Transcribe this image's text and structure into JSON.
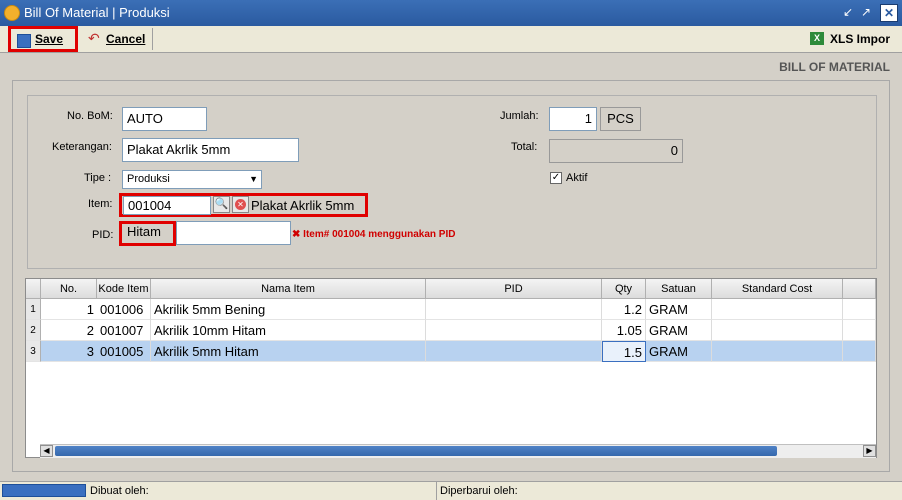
{
  "window": {
    "title": "Bill Of Material | Produksi"
  },
  "toolbar": {
    "save_label": "Save",
    "cancel_label": "Cancel",
    "xls_label": "XLS Impor"
  },
  "heading": "BILL OF MATERIAL",
  "form": {
    "no_bom_label": "No. BoM:",
    "no_bom_value": "AUTO",
    "keterangan_label": "Keterangan:",
    "keterangan_value": "Plakat Akrlik 5mm",
    "tipe_label": "Tipe :",
    "tipe_value": "Produksi",
    "item_label": "Item:",
    "item_code": "001004",
    "item_name": "Plakat Akrlik 5mm",
    "pid_label": "PID:",
    "pid_value": "Hitam",
    "pid_warning": "Item# 001004 menggunakan PID",
    "jumlah_label": "Jumlah:",
    "jumlah_value": "1",
    "jumlah_unit": "PCS",
    "total_label": "Total:",
    "total_value": "0",
    "aktif_label": "Aktif"
  },
  "table": {
    "columns": [
      "No.",
      "Kode Item",
      "Nama Item",
      "PID",
      "Qty",
      "Satuan",
      "Standard Cost"
    ],
    "rows": [
      {
        "rownum": "1",
        "no": "1",
        "kode": "001006",
        "nama": "Akrilik 5mm Bening",
        "pid": "",
        "qty": "1.2",
        "satuan": "GRAM",
        "cost": ""
      },
      {
        "rownum": "2",
        "no": "2",
        "kode": "001007",
        "nama": "Akrilik 10mm Hitam",
        "pid": "",
        "qty": "1.05",
        "satuan": "GRAM",
        "cost": ""
      },
      {
        "rownum": "3",
        "no": "3",
        "kode": "001005",
        "nama": "Akrilik 5mm Hitam",
        "pid": "",
        "qty": "1.5",
        "satuan": "GRAM",
        "cost": ""
      }
    ]
  },
  "status": {
    "dibuat_label": "Dibuat oleh:",
    "diperbarui_label": "Diperbarui oleh:"
  }
}
